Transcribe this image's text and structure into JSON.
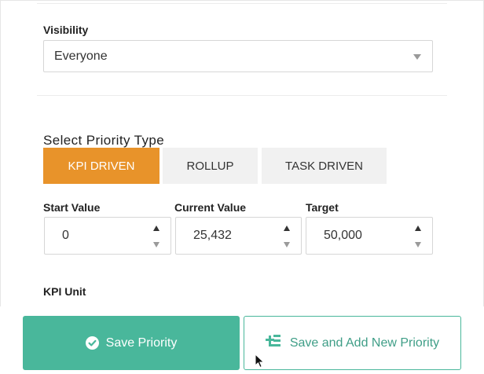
{
  "visibility": {
    "label": "Visibility",
    "selected": "Everyone",
    "caret_icon": "chevron-down-icon"
  },
  "priority_type": {
    "title": "Select Priority Type",
    "options": [
      {
        "label": "KPI DRIVEN",
        "active": true
      },
      {
        "label": "ROLLUP",
        "active": false
      },
      {
        "label": "TASK DRIVEN",
        "active": false
      }
    ]
  },
  "values": {
    "start": {
      "label": "Start Value",
      "value": "0"
    },
    "current": {
      "label": "Current Value",
      "value": "25,432"
    },
    "target": {
      "label": "Target",
      "value": "50,000"
    }
  },
  "kpi_unit": {
    "label": "KPI Unit"
  },
  "actions": {
    "save_label": "Save Priority",
    "save_icon": "check-circle-icon",
    "save_new_label": "Save and Add New Priority",
    "save_new_icon": "add-list-icon"
  },
  "colors": {
    "accent_orange": "#e8932a",
    "accent_green": "#49b79b"
  }
}
